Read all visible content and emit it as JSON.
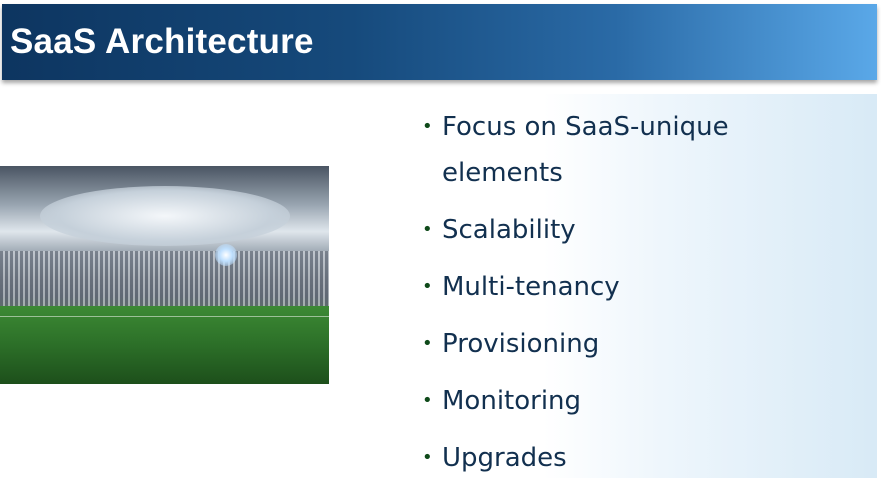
{
  "slide": {
    "title": "SaaS Architecture",
    "bullets": [
      "Focus on SaaS-unique elements",
      "Scalability",
      "Multi-tenancy",
      "Provisioning",
      "Monitoring",
      "Upgrades"
    ],
    "bullet_glyph": "•",
    "colors": {
      "banner_dark": "#0d3560",
      "banner_light": "#5aa8e8",
      "text": "#12304f",
      "bullet": "#0f4a1a"
    }
  }
}
